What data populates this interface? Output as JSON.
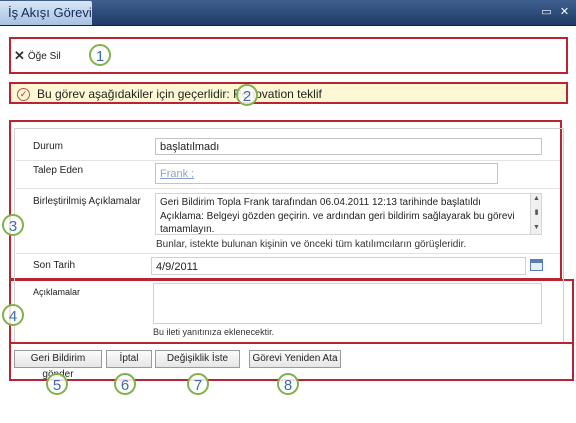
{
  "window": {
    "title": "İş Akışı Görevi",
    "min_icon": "minimize-icon",
    "close_icon": "close-icon"
  },
  "toolbar": {
    "delete_label": "Öğe Sil",
    "delete_icon": "x-icon"
  },
  "notice": {
    "text": "Bu görev aşağıdakiler için geçerlidir: Renovation teklif",
    "icon": "check-circle-icon"
  },
  "form": {
    "status": {
      "label": "Durum",
      "value": "başlatılmadı"
    },
    "requester": {
      "label": "Talep Eden",
      "value": "Frank ;"
    },
    "comments": {
      "label": "Birleştirilmiş Açıklamalar",
      "lines": [
        "Geri Bildirim Topla Frank tarafından 06.04.2011 12:13 tarihinde başlatıldı",
        "Açıklama: Belgeyi gözden geçirin. ve ardından geri bildirim sağlayarak bu görevi",
        "tamamlayın."
      ],
      "hint": "Bunlar, istekte bulunan kişinin ve önceki tüm katılımcıların görüşleridir."
    },
    "due_date": {
      "label": "Son Tarih",
      "value": "4/9/2011",
      "icon": "calendar-icon"
    },
    "response": {
      "label": "Açıklamalar",
      "value": "",
      "hint": "Bu ileti yanıtınıza eklenecektir."
    }
  },
  "buttons": {
    "send_feedback": "Geri Bildirim gönder",
    "cancel": "İptal",
    "request_change": "Değişiklik İste",
    "reassign": "Görevi Yeniden Ata"
  },
  "callouts": [
    "1",
    "2",
    "3",
    "4",
    "5",
    "6",
    "7",
    "8"
  ],
  "colors": {
    "callout_border": "#b8242f",
    "callout_circle": "#7fb24a",
    "title_bar": "#1f3b66",
    "notice_bg": "#fdf7d3"
  }
}
